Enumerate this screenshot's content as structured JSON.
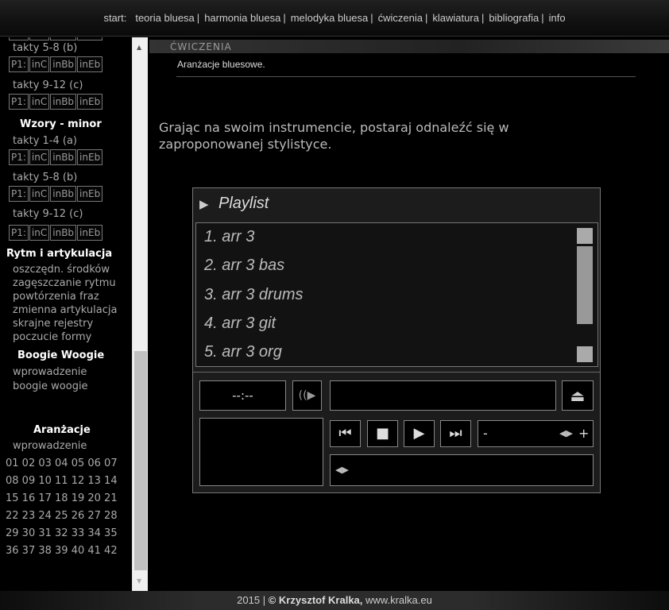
{
  "nav": {
    "prefix": "start:",
    "items": [
      "teoria bluesa",
      "harmonia bluesa",
      "melodyka bluesa",
      "ćwiczenia",
      "klawiatura",
      "bibliografia",
      "info"
    ],
    "separator": "|"
  },
  "sidebar": {
    "button_labels": [
      "P1:",
      "inC",
      "inBb",
      "inEb"
    ],
    "major_takty_5_8": "takty 5-8 (b)",
    "major_takty_9_12": "takty 9-12 (c)",
    "minor_heading": "Wzory - minor",
    "minor_takty_1_4": "takty 1-4 (a)",
    "minor_takty_5_8": "takty 5-8 (b)",
    "minor_takty_9_12": "takty 9-12 (c)",
    "rytm_heading": "Rytm i artykulacja",
    "rytm_items": [
      "oszczędn. środków",
      "zagęszczanie rytmu",
      "powtórzenia fraz",
      "zmienna artykulacja",
      "skrajne rejestry",
      "poczucie formy"
    ],
    "boogie_heading": "Boogie Woogie",
    "boogie_items": [
      "wprowadzenie",
      "boogie woogie"
    ],
    "aranz_heading": "Aranżacje",
    "aranz_intro": "wprowadzenie",
    "aranz_rows": [
      "01 02 03 04 05 06 07",
      "08 09 10 11 12 13 14",
      "15 16 17 18 19 20 21",
      "22 23 24 25 26 27 28",
      "29 30 31 32 33 34 35",
      "36 37 38 39 40 41 42"
    ]
  },
  "main": {
    "section_title": "ĆWICZENIA",
    "subtitle": "Aranżacje bluesowe.",
    "instruction": "Grając na swoim instrumencie, postaraj odnaleźć się w zaproponowanej stylistyce."
  },
  "player": {
    "playlist_title": "Playlist",
    "tracks": [
      "1. arr 3",
      "2. arr 3 bas",
      "3. arr 3 drums",
      "4. arr 3 git",
      "5. arr 3 org"
    ],
    "time": "--:--",
    "volume_minus": "-",
    "volume_plus": "+"
  },
  "footer": {
    "year": "2015 |",
    "copyright": "© Krzysztof Kralka,",
    "site": "www.kralka.eu"
  }
}
